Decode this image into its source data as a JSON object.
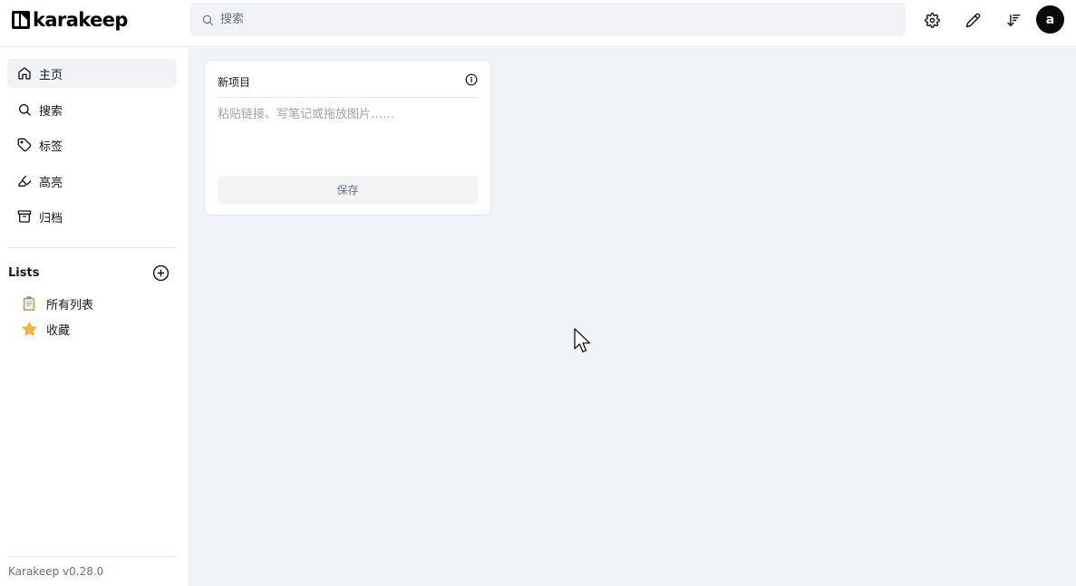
{
  "header": {
    "app_name": "karakeep",
    "search_placeholder": "搜索",
    "avatar_initial": "a",
    "icons": [
      "settings-gear-icon",
      "pencil-edit-icon",
      "sort-icon"
    ]
  },
  "sidebar": {
    "nav_items": [
      {
        "label": "主页",
        "icon": "home-icon"
      },
      {
        "label": "搜索",
        "icon": "search-icon"
      },
      {
        "label": "标签",
        "icon": "tag-icon"
      },
      {
        "label": "高亮",
        "icon": "highlighter-icon"
      },
      {
        "label": "归档",
        "icon": "archive-icon"
      }
    ],
    "lists_title": "Lists",
    "lists": [
      {
        "emoji": "📋",
        "label": "所有列表"
      },
      {
        "emoji": "⭐",
        "label": "收藏"
      }
    ],
    "version": "Karakeep v0.28.0"
  },
  "main": {
    "new_item_card": {
      "title": "新项目",
      "placeholder": "粘贴链接、写笔记或拖放图片……",
      "save_label": "保存"
    }
  },
  "colors": {
    "main_bg": "#f0f3f8",
    "active_nav_bg": "#f1f3f6",
    "avatar_bg": "#0a0a0a"
  }
}
